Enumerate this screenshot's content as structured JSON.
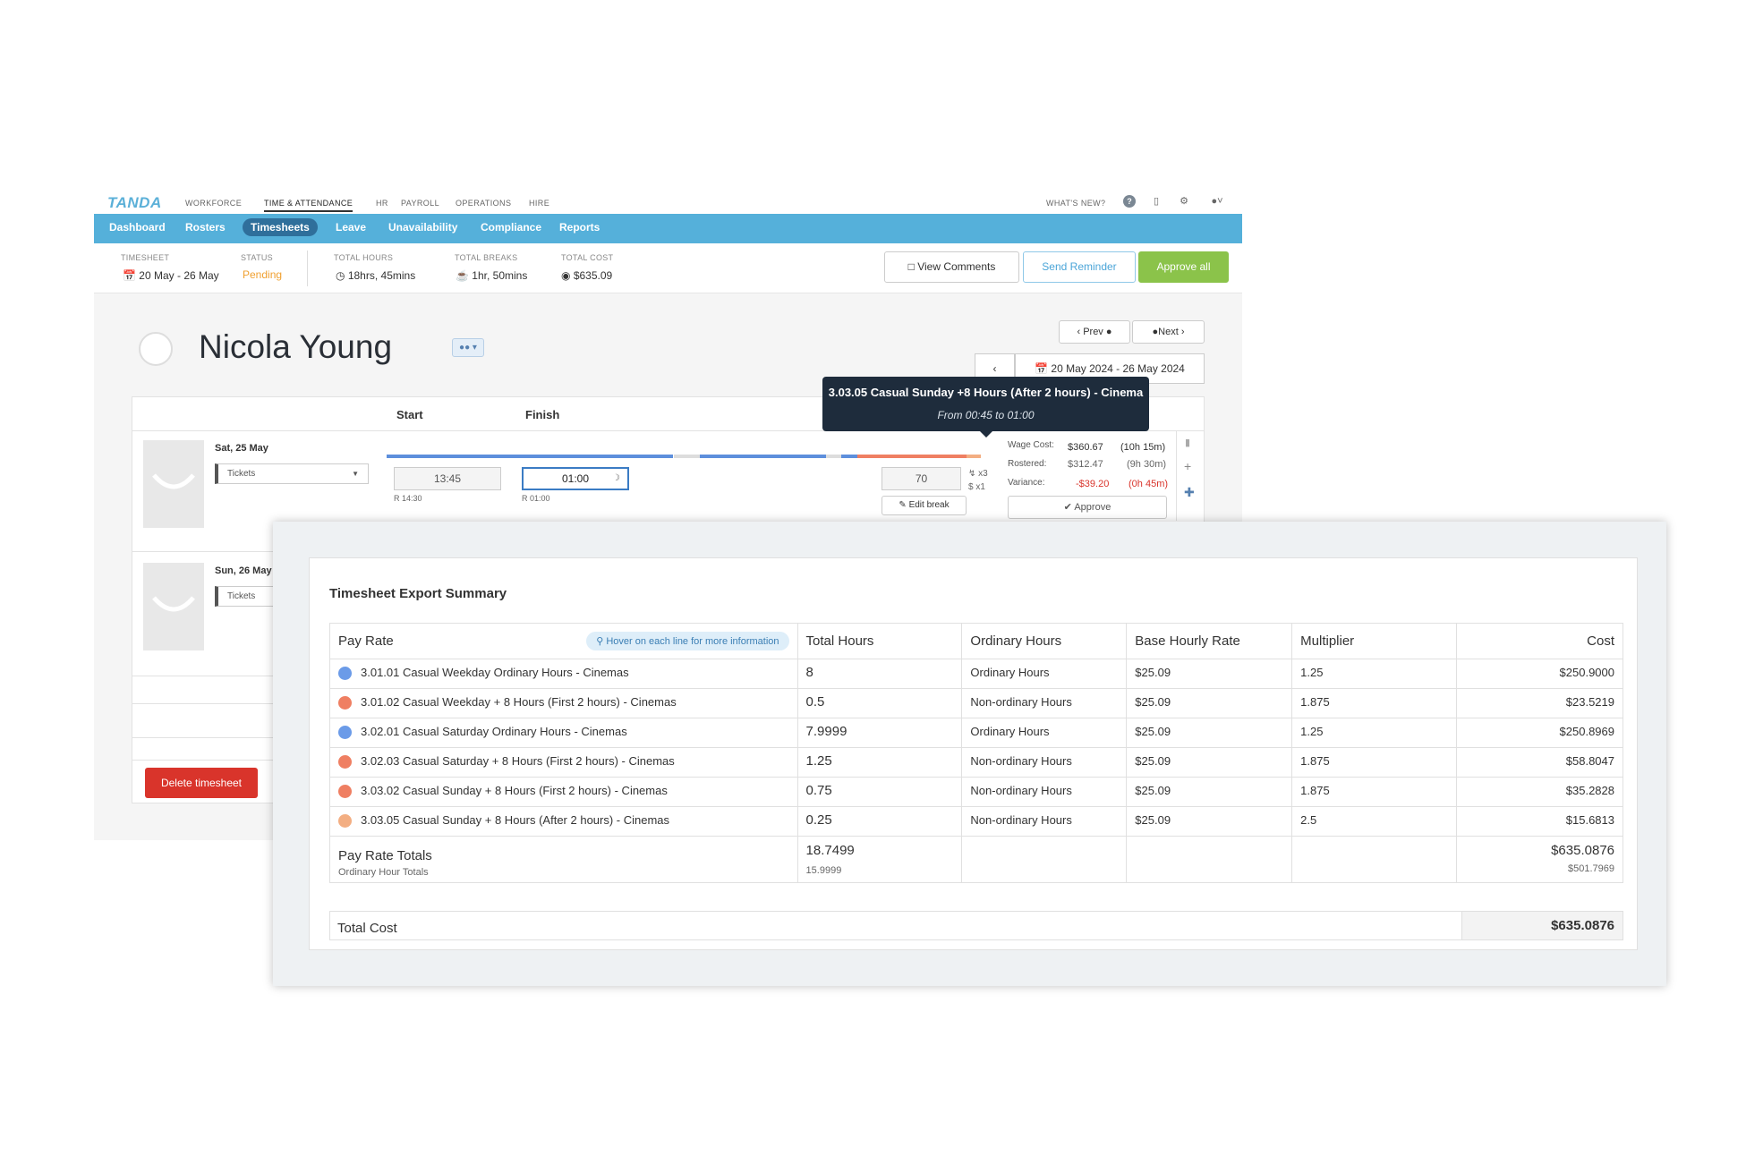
{
  "topnav": {
    "logo": "TANDA",
    "modules": [
      "WORKFORCE",
      "TIME & ATTENDANCE",
      "HR",
      "PAYROLL",
      "OPERATIONS",
      "HIRE"
    ],
    "whats_new": "WHAT'S NEW?",
    "icons": [
      "help-icon",
      "chat-icon",
      "gear-icon",
      "user-account-icon"
    ]
  },
  "subnav": {
    "items": [
      "Dashboard",
      "Rosters",
      "Timesheets",
      "Leave",
      "Unavailability",
      "Compliance",
      "Reports"
    ],
    "active": "Timesheets"
  },
  "summary": {
    "timesheet_label": "TIMESHEET",
    "timesheet_value": "20 May - 26 May",
    "status_label": "STATUS",
    "status_value": "Pending",
    "hours_label": "TOTAL HOURS",
    "hours_value": "18hrs, 45mins",
    "breaks_label": "TOTAL BREAKS",
    "breaks_value": "1hr, 50mins",
    "cost_label": "TOTAL COST",
    "cost_value": "$635.09",
    "view_comments": "View Comments",
    "send_reminder": "Send Reminder",
    "approve_all": "Approve all"
  },
  "employee": {
    "name": "Nicola Young",
    "prev": "Prev",
    "next": "Next",
    "date_range": "20 May 2024 - 26 May 2024"
  },
  "shift_table": {
    "start_header": "Start",
    "finish_header": "Finish",
    "shifts": [
      {
        "day": "Sat, 25 May",
        "team": "Tickets",
        "start": "13:45",
        "start_rostered": "R 14:30",
        "finish": "01:00",
        "finish_rostered": "R 01:00",
        "break_minutes": "70",
        "multiplier_a": "x3",
        "multiplier_b": "x1",
        "edit_break": "Edit break",
        "wage_cost_label": "Wage Cost:",
        "wage_cost": "$360.67",
        "wage_cost_hours": "(10h 15m)",
        "rostered_label": "Rostered:",
        "rostered": "$312.47",
        "rostered_hours": "(9h 30m)",
        "variance_label": "Variance:",
        "variance": "-$39.20",
        "variance_hours": "(0h 45m)",
        "approve": "Approve"
      },
      {
        "day": "Sun, 26 May",
        "team": "Tickets"
      }
    ],
    "delete_button": "Delete timesheet"
  },
  "tooltip": {
    "title": "3.03.05 Casual Sunday +8 Hours (After 2 hours) - Cinema",
    "subtitle": "From 00:45 to 01:00"
  },
  "export": {
    "title": "Timesheet Export Summary",
    "headers": {
      "pay_rate": "Pay Rate",
      "hover_hint": "Hover on each line for more information",
      "total_hours": "Total Hours",
      "ordinary_hours": "Ordinary Hours",
      "base_rate": "Base Hourly Rate",
      "multiplier": "Multiplier",
      "cost": "Cost"
    },
    "rows": [
      {
        "pay_rate": "3.01.01 Casual Weekday Ordinary Hours - Cinemas",
        "color": "#6b9be8",
        "total_hours": "8",
        "ordinary": "Ordinary Hours",
        "base_rate": "$25.09",
        "multiplier": "1.25",
        "cost": "$250.9000"
      },
      {
        "pay_rate": "3.01.02 Casual Weekday + 8 Hours (First 2 hours) - Cinemas",
        "color": "#ef7f62",
        "total_hours": "0.5",
        "ordinary": "Non-ordinary Hours",
        "base_rate": "$25.09",
        "multiplier": "1.875",
        "cost": "$23.5219"
      },
      {
        "pay_rate": "3.02.01 Casual Saturday Ordinary Hours - Cinemas",
        "color": "#6b9be8",
        "total_hours": "7.9999",
        "ordinary": "Ordinary Hours",
        "base_rate": "$25.09",
        "multiplier": "1.25",
        "cost": "$250.8969"
      },
      {
        "pay_rate": "3.02.03 Casual Saturday + 8 Hours (First 2 hours) - Cinemas",
        "color": "#ef7f62",
        "total_hours": "1.25",
        "ordinary": "Non-ordinary Hours",
        "base_rate": "$25.09",
        "multiplier": "1.875",
        "cost": "$58.8047"
      },
      {
        "pay_rate": "3.03.02 Casual Sunday + 8 Hours (First 2 hours) - Cinemas",
        "color": "#ef7f62",
        "total_hours": "0.75",
        "ordinary": "Non-ordinary Hours",
        "base_rate": "$25.09",
        "multiplier": "1.875",
        "cost": "$35.2828"
      },
      {
        "pay_rate": "3.03.05 Casual Sunday + 8 Hours (After 2 hours) - Cinemas",
        "color": "#f3ae82",
        "total_hours": "0.25",
        "ordinary": "Non-ordinary Hours",
        "base_rate": "$25.09",
        "multiplier": "2.5",
        "cost": "$15.6813"
      }
    ],
    "totals": {
      "label": "Pay Rate Totals",
      "sub_label": "Ordinary Hour Totals",
      "total_hours": "18.7499",
      "ordinary_hours": "15.9999",
      "cost": "$635.0876",
      "ordinary_cost": "$501.7969"
    },
    "total_cost_label": "Total Cost",
    "total_cost": "$635.0876"
  }
}
